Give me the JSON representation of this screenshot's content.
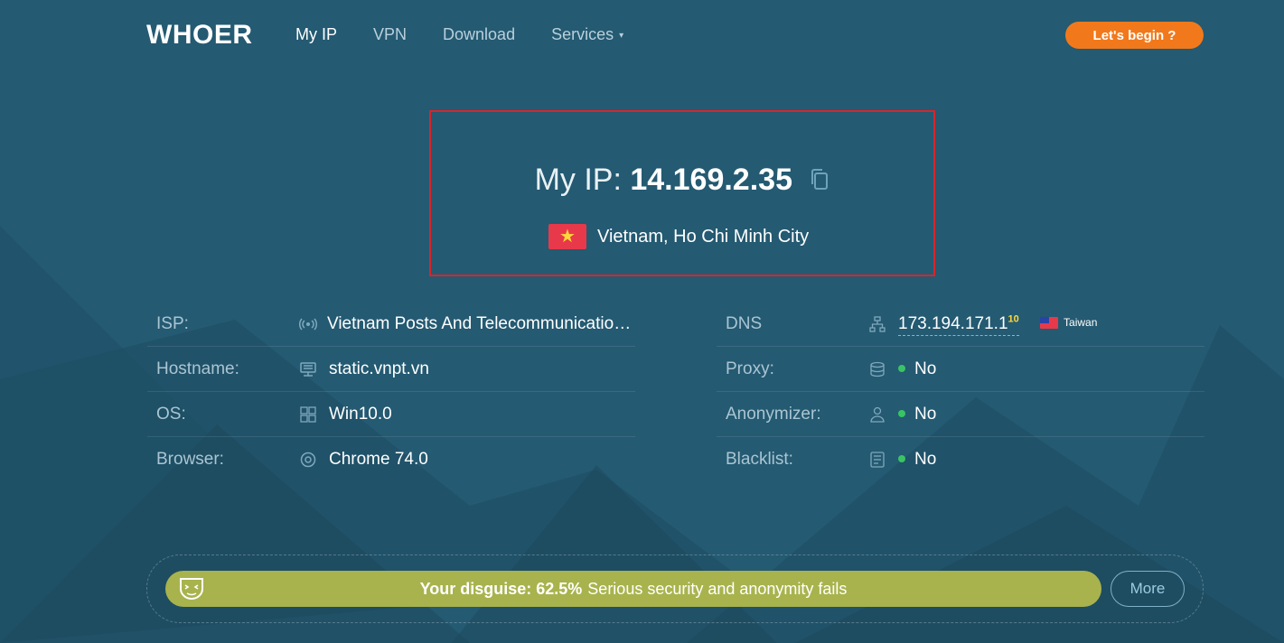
{
  "header": {
    "logo": "WHOER",
    "nav": [
      "My IP",
      "VPN",
      "Download",
      "Services"
    ],
    "cta": "Let's begin ?"
  },
  "ip": {
    "label": "My IP:",
    "value": "14.169.2.35",
    "location": "Vietnam, Ho Chi Minh City",
    "flag_star": "★"
  },
  "left_rows": [
    {
      "label": "ISP:",
      "value": "Vietnam Posts And Telecommunications Group",
      "icon": "signal-icon"
    },
    {
      "label": "Hostname:",
      "value": "static.vnpt.vn",
      "icon": "server-icon"
    },
    {
      "label": "OS:",
      "value": "Win10.0",
      "icon": "windows-icon"
    },
    {
      "label": "Browser:",
      "value": "Chrome 74.0",
      "icon": "chrome-icon"
    }
  ],
  "right_rows": [
    {
      "label": "DNS",
      "value": "173.194.171.1",
      "sup": "10",
      "country": "Taiwan",
      "icon": "network-icon"
    },
    {
      "label": "Proxy:",
      "value": "No",
      "icon": "database-icon"
    },
    {
      "label": "Anonymizer:",
      "value": "No",
      "icon": "user-icon"
    },
    {
      "label": "Blacklist:",
      "value": "No",
      "icon": "list-icon"
    }
  ],
  "disguise": {
    "label": "Your disguise:",
    "percent": "62.5%",
    "text": "Serious security and anonymity fails",
    "more": "More"
  },
  "colors": {
    "background": "#245a72",
    "accent": "#f2791b",
    "highlight_border": "#d8252b",
    "disguise_bar": "#a8b34d",
    "status_ok": "#39c463"
  }
}
